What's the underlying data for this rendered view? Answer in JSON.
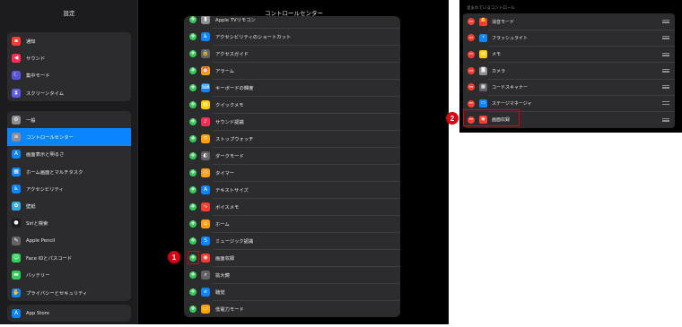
{
  "sidebar": {
    "title": "設定",
    "group1": [
      {
        "label": "通知",
        "icon": "bell-icon",
        "glyph": "▪",
        "color": "#ff3b30"
      },
      {
        "label": "サウンド",
        "icon": "speaker-icon",
        "glyph": "◀",
        "color": "#ff2d55"
      },
      {
        "label": "集中モード",
        "icon": "moon-icon",
        "glyph": "☾",
        "color": "#5856d6"
      },
      {
        "label": "スクリーンタイム",
        "icon": "hourglass-icon",
        "glyph": "⧗",
        "color": "#5e5ce6"
      }
    ],
    "group2": [
      {
        "label": "一般",
        "icon": "gear-icon",
        "glyph": "⚙",
        "color": "#8e8e93"
      },
      {
        "label": "コントロールセンター",
        "icon": "control-center-icon",
        "glyph": "≡",
        "color": "#8e8e93",
        "active": true
      },
      {
        "label": "画面表示と明るさ",
        "icon": "text-size-icon",
        "glyph": "A",
        "color": "#0a84ff"
      },
      {
        "label": "ホーム画面とマルチタスク",
        "icon": "home-screen-icon",
        "glyph": "▦",
        "color": "#0a84ff"
      },
      {
        "label": "アクセシビリティ",
        "icon": "accessibility-icon",
        "glyph": "♿",
        "color": "#0a84ff"
      },
      {
        "label": "壁紙",
        "icon": "wallpaper-icon",
        "glyph": "✿",
        "color": "#32ade6"
      },
      {
        "label": "Siriと検索",
        "icon": "siri-icon",
        "glyph": "●",
        "color": "#1c1c1e"
      },
      {
        "label": "Apple Pencil",
        "icon": "pencil-icon",
        "glyph": "✎",
        "color": "#636366"
      },
      {
        "label": "Face IDとパスコード",
        "icon": "face-id-icon",
        "glyph": "☺",
        "color": "#30d158"
      },
      {
        "label": "バッテリー",
        "icon": "battery-icon",
        "glyph": "▬",
        "color": "#30d158"
      },
      {
        "label": "プライバシーとセキュリティ",
        "icon": "hand-icon",
        "glyph": "✋",
        "color": "#0a84ff"
      }
    ],
    "group3": [
      {
        "label": "App Store",
        "icon": "app-store-icon",
        "glyph": "A",
        "color": "#0a84ff"
      }
    ]
  },
  "main": {
    "title": "コントロールセンター",
    "controls": [
      {
        "label": "Apple TVリモコン",
        "icon": "remote-icon",
        "glyph": "▮",
        "color": "#8e8e93"
      },
      {
        "label": "アクセシビリティのショートカット",
        "icon": "accessibility-shortcut-icon",
        "glyph": "♿",
        "color": "#0a84ff"
      },
      {
        "label": "アクセスガイド",
        "icon": "lock-icon",
        "glyph": "🔒",
        "color": "#636366"
      },
      {
        "label": "アラーム",
        "icon": "alarm-icon",
        "glyph": "⏰",
        "color": "#ff9f0a"
      },
      {
        "label": "キーボードの輝度",
        "icon": "keyboard-icon",
        "glyph": "⌨",
        "color": "#0a84ff"
      },
      {
        "label": "クイックメモ",
        "icon": "quick-note-icon",
        "glyph": "▤",
        "color": "#ffcc00"
      },
      {
        "label": "サウンド認識",
        "icon": "sound-recognition-icon",
        "glyph": "♪",
        "color": "#ff2d55"
      },
      {
        "label": "ストップウォッチ",
        "icon": "stopwatch-icon",
        "glyph": "⏱",
        "color": "#ff9f0a"
      },
      {
        "label": "ダークモード",
        "icon": "dark-mode-icon",
        "glyph": "◐",
        "color": "#636366"
      },
      {
        "label": "タイマー",
        "icon": "timer-icon",
        "glyph": "◷",
        "color": "#ff9f0a"
      },
      {
        "label": "テキストサイズ",
        "icon": "text-size-control-icon",
        "glyph": "A",
        "color": "#0a84ff"
      },
      {
        "label": "ボイスメモ",
        "icon": "voice-memo-icon",
        "glyph": "∿",
        "color": "#ff3b30"
      },
      {
        "label": "ホーム",
        "icon": "home-icon",
        "glyph": "⌂",
        "color": "#ff9f0a"
      },
      {
        "label": "ミュージック認識",
        "icon": "shazam-icon",
        "glyph": "S",
        "color": "#0a84ff"
      },
      {
        "label": "画面収録",
        "icon": "screen-record-icon",
        "glyph": "◉",
        "color": "#ff3b30"
      },
      {
        "label": "拡大鏡",
        "icon": "magnifier-icon",
        "glyph": "⌕",
        "color": "#636366"
      },
      {
        "label": "聴覚",
        "icon": "ear-icon",
        "glyph": "ℯ",
        "color": "#0a84ff"
      },
      {
        "label": "低電力モード",
        "icon": "low-power-icon",
        "glyph": "▭",
        "color": "#ff9f0a"
      }
    ]
  },
  "right_panel": {
    "header": "含まれているコントロール",
    "controls": [
      {
        "label": "消音モード",
        "icon": "silent-mode-icon",
        "glyph": "🔔",
        "color": "#ff3b30"
      },
      {
        "label": "フラッシュライト",
        "icon": "flashlight-icon",
        "glyph": "⚡",
        "color": "#0a84ff"
      },
      {
        "label": "メモ",
        "icon": "notes-icon",
        "glyph": "▤",
        "color": "#ffcc00"
      },
      {
        "label": "カメラ",
        "icon": "camera-icon",
        "glyph": "◙",
        "color": "#8e8e93"
      },
      {
        "label": "コードスキャナー",
        "icon": "qr-code-icon",
        "glyph": "▦",
        "color": "#636366"
      },
      {
        "label": "ステージマネージャ",
        "icon": "stage-manager-icon",
        "glyph": "▭",
        "color": "#0a84ff"
      },
      {
        "label": "画面収録",
        "icon": "screen-record-icon",
        "glyph": "◉",
        "color": "#ff3b30"
      }
    ]
  },
  "annotations": {
    "step1": "1",
    "step2": "2"
  }
}
